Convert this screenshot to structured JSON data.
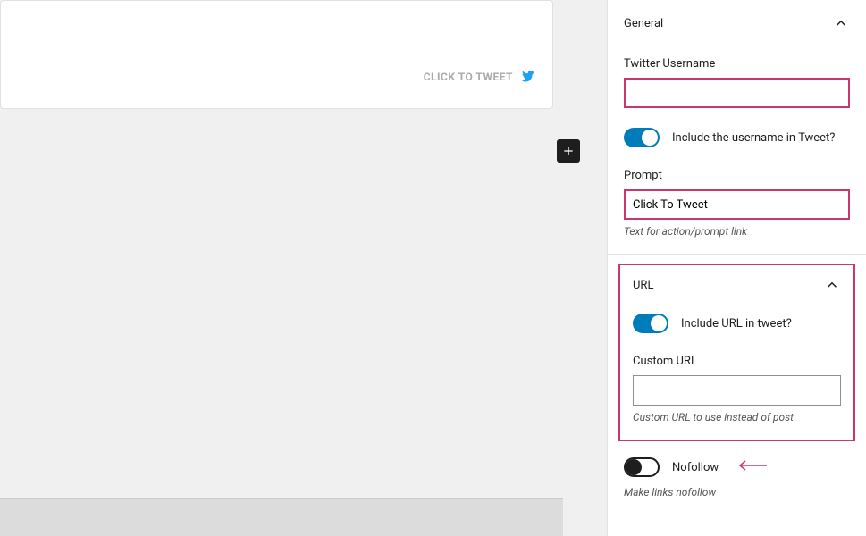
{
  "editor": {
    "tweet_prompt": "CLICK TO TWEET"
  },
  "sidebar": {
    "general": {
      "title": "General",
      "twitter_username_label": "Twitter Username",
      "twitter_username_value": "",
      "include_username_label": "Include the username in Tweet?",
      "include_username_on": true,
      "prompt_label": "Prompt",
      "prompt_value": "Click To Tweet",
      "prompt_help": "Text for action/prompt link"
    },
    "url": {
      "title": "URL",
      "include_url_label": "Include URL in tweet?",
      "include_url_on": true,
      "custom_url_label": "Custom URL",
      "custom_url_value": "",
      "custom_url_help": "Custom URL to use instead of post"
    },
    "nofollow": {
      "label": "Nofollow",
      "on": false,
      "help": "Make links nofollow"
    }
  }
}
